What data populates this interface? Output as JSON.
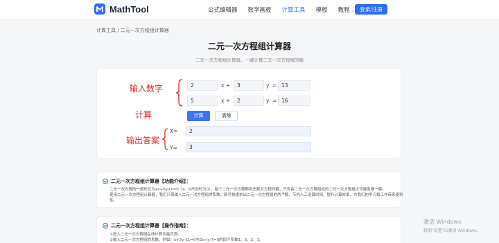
{
  "app": {
    "logo_text": "MathTool"
  },
  "nav": {
    "items": [
      {
        "label": "公式编辑器"
      },
      {
        "label": "数学画板"
      },
      {
        "label": "计算工具"
      },
      {
        "label": "模板"
      },
      {
        "label": "教程"
      }
    ],
    "active_index": 2,
    "login_label": "登录/注册"
  },
  "breadcrumb": "计算工具 / 二元一次方程组计算器",
  "page": {
    "title": "二元一次方程组计算器",
    "subtitle": "二元一次方程组计算器，一键计算二元一次方程组的解"
  },
  "equations": [
    {
      "a": "2",
      "b": "3",
      "c": "13",
      "x_op": "x +",
      "y_op": "y",
      "eq": "="
    },
    {
      "a": "5",
      "b": "2",
      "c": "16",
      "x_op": "x +",
      "y_op": "y",
      "eq": "="
    }
  ],
  "buttons": {
    "calc": "计算",
    "clear": "清除"
  },
  "output": {
    "x_label": "X=",
    "x_value": "2",
    "y_label": "Y=",
    "y_value": "3"
  },
  "annotations": {
    "input": "输入数字",
    "calc": "计算",
    "output": "输出答案",
    "color": "#e0281e"
  },
  "info_intro": {
    "title": "二元一次方程组计算器【功能介绍】：",
    "line1": "二元一次方程的一般形式为ax+by+c=0（a、b不同时为0），每个二元一次方程都有无数对方程的解，只有由二元一次方程组成的二元一次方程组才可能有唯一解。",
    "line2": "使用二元一次方程组计算器，我们只需输入二元一次方程组的系数，即可快速求出二元一次方程组的两个解，节约人工运算时间，提升计算效率，为我们的学习和工作带来便利",
    "line3": "性。"
  },
  "info_guide": {
    "title": "二元一次方程组计算器【操作指南】：",
    "line1": "①进入二元一次方程组在线计算功能页面。",
    "line2": "②输入二元一次方程组的系数，例如：x+3y-11=0与2x+y-7=0的四个系数1、3、2、1。"
  },
  "watermark": {
    "line1": "激活 Windows",
    "line2": "转到\"设置\"以激活 Windows。"
  },
  "colors": {
    "accent": "#2f6bff",
    "annotation": "#e0281e"
  }
}
